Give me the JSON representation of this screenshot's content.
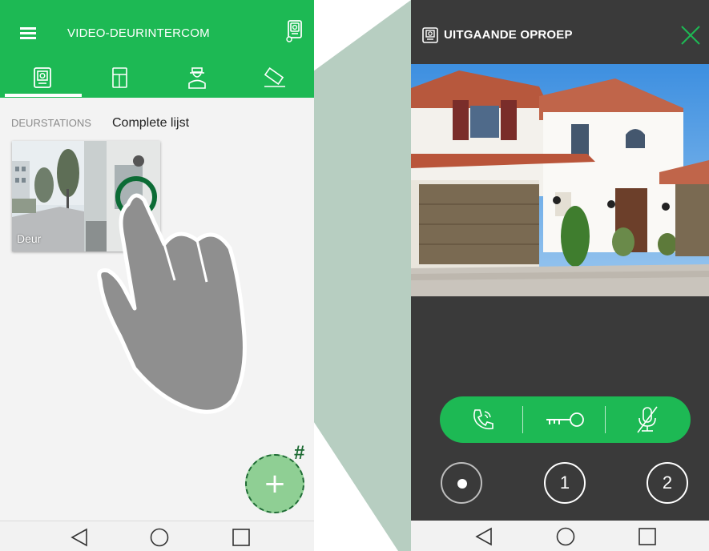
{
  "left_screen": {
    "app_title": "VIDEO-DEURINTERCOM",
    "section_label": "DEURSTATIONS",
    "list_label": "Complete lijst",
    "door_card_label": "Deur",
    "fab_symbol": "+",
    "callout_marker": "#",
    "tabs": [
      "intercom-icon",
      "door-panel-icon",
      "concierge-icon",
      "camera-icon"
    ],
    "accent_color": "#1db954"
  },
  "right_screen": {
    "title": "UITGAANDE OPROEP",
    "round_buttons": [
      "1",
      "2"
    ],
    "actions": [
      "phone-call-icon",
      "key-icon",
      "mute-microphone-icon"
    ],
    "background_color": "#3a3a3a"
  },
  "nav_icons": [
    "back-icon",
    "home-icon",
    "recents-icon"
  ]
}
